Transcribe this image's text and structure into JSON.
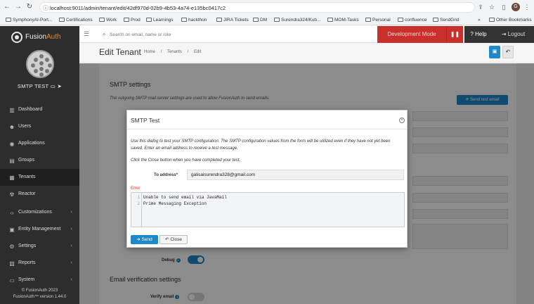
{
  "browser": {
    "url": "localhost:9011/admin/tenant/edit/42df970d-02b9-4b53-4a74-e135bc0417c2",
    "profile_initial": "G",
    "bookmarks": [
      {
        "label": "SymphonyAI-Port..."
      },
      {
        "label": "Certifications"
      },
      {
        "label": "Work"
      },
      {
        "label": "Prod"
      },
      {
        "label": "Learnings"
      },
      {
        "label": "hackthon"
      },
      {
        "label": "JIRA Tickets"
      },
      {
        "label": "DM"
      },
      {
        "label": "Surendra324/Kub..."
      },
      {
        "label": "MOM-Tasks"
      },
      {
        "label": "Personal"
      },
      {
        "label": "confluence"
      },
      {
        "label": "SendGrid"
      },
      {
        "label": "»"
      },
      {
        "label": "Other Bookmarks"
      }
    ]
  },
  "sidebar": {
    "brand_prefix": "Fusion",
    "brand_suffix": "Auth",
    "tenant_name": "SMTP TEST",
    "items": [
      {
        "label": "Dashboard",
        "icon": "▥",
        "chevron": ""
      },
      {
        "label": "Users",
        "icon": "☻",
        "chevron": ""
      },
      {
        "label": "Applications",
        "icon": "◉",
        "chevron": ""
      },
      {
        "label": "Groups",
        "icon": "▤",
        "chevron": ""
      },
      {
        "label": "Tenants",
        "icon": "▦",
        "chevron": ""
      },
      {
        "label": "Reactor",
        "icon": "☢",
        "chevron": ""
      },
      {
        "label": "Customizations",
        "icon": "‹›",
        "chevron": "‹"
      },
      {
        "label": "Entity Management",
        "icon": "▣",
        "chevron": "‹"
      },
      {
        "label": "Settings",
        "icon": "⚙",
        "chevron": "‹"
      },
      {
        "label": "Reports",
        "icon": "▨",
        "chevron": "‹"
      },
      {
        "label": "System",
        "icon": "▭",
        "chevron": "‹"
      }
    ],
    "footer_line1": "© FusionAuth 2023",
    "footer_line2": "FusionAuth™ version 1.44.0"
  },
  "header": {
    "search_placeholder": "Search on email, name or role",
    "dev_mode": "Development Mode",
    "help": "Help",
    "logout": "Logout"
  },
  "page": {
    "title": "Edit Tenant",
    "breadcrumbs": [
      "Home",
      "/",
      "Tenants",
      "/",
      "Edit"
    ]
  },
  "smtp_section": {
    "title": "SMTP settings",
    "description": "The outgoing SMTP mail server settings are used to allow FusionAuth to send emails.",
    "send_test_email": "Send test email",
    "debug_label": "Debug",
    "debug_on": true
  },
  "email_verification_section": {
    "title": "Email verification settings",
    "verify_email_label": "Verify email",
    "verify_email_on": false
  },
  "modal": {
    "title": "SMTP Test",
    "para1": "Use this dialog to test your SMTP configuration. The SMTP configuration values from the form will be utilized even if they have not yet been saved. Enter an email address to receive a test message.",
    "para2": "Click the Close button when you have completed your test.",
    "to_address_label": "To address*",
    "to_address_value": "galisaisurendra328@gmail.com",
    "error_label": "Error",
    "error_lines": [
      {
        "n": "1",
        "text": "Unable to send email via JavaMail"
      },
      {
        "n": "2",
        "text": "Prime Messaging Exception"
      }
    ],
    "send_label": "Send",
    "close_label": "Close"
  },
  "colors": {
    "primary": "#1e88c8",
    "danger": "#c9302c",
    "brand_orange": "#f58320",
    "sidebar_bg": "#2d2d2d"
  }
}
